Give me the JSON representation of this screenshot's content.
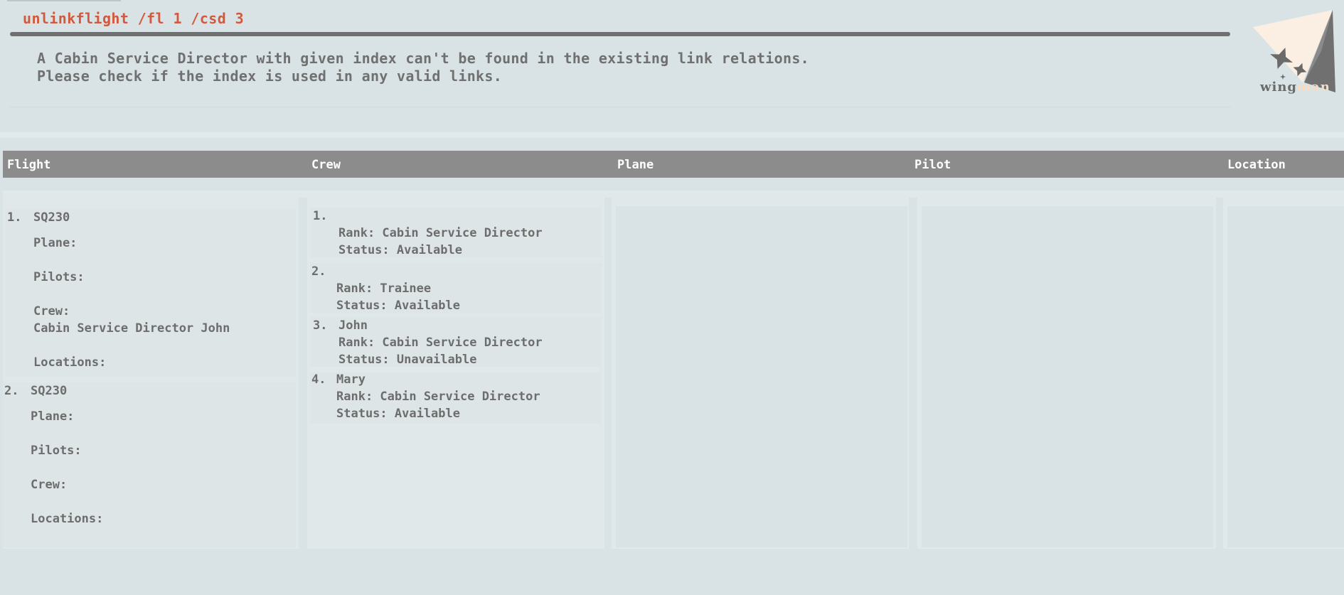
{
  "command": {
    "text": "unlinkflight /fl 1 /csd 3"
  },
  "result": {
    "lines": [
      "A Cabin Service Director with given index can't be found in the existing link relations.",
      "Please check if the index is used in any valid links."
    ]
  },
  "logo": {
    "text_main": "wing",
    "text_accent": "man",
    "accent_color": "#f6dcc4"
  },
  "columns": {
    "headers": [
      "Flight",
      "Crew",
      "Plane",
      "Pilot",
      "Location"
    ]
  },
  "flights": [
    {
      "index": "1.",
      "code": "SQ230",
      "plane_label": "Plane:",
      "pilots_label": "Pilots:",
      "crew_label": "Crew:",
      "crew_value": "Cabin Service Director John",
      "locations_label": "Locations:"
    },
    {
      "index": "2.",
      "code": "SQ230",
      "plane_label": "Plane:",
      "pilots_label": "Pilots:",
      "crew_label": "Crew:",
      "crew_value": "",
      "locations_label": "Locations:"
    }
  ],
  "crew": [
    {
      "index": "1.",
      "name": "",
      "rank": "Rank: Cabin Service Director",
      "status": "Status: Available"
    },
    {
      "index": "2.",
      "name": "",
      "rank": "Rank: Trainee",
      "status": "Status: Available"
    },
    {
      "index": "3.",
      "name": "John",
      "rank": "Rank: Cabin Service Director",
      "status": "Status: Unavailable"
    },
    {
      "index": "4.",
      "name": "Mary",
      "rank": "Rank: Cabin Service Director",
      "status": "Status: Available"
    }
  ],
  "colors": {
    "command_text": "#cf5a3d",
    "header_bg": "#8c8c8c",
    "background": "#d9e3e6"
  }
}
